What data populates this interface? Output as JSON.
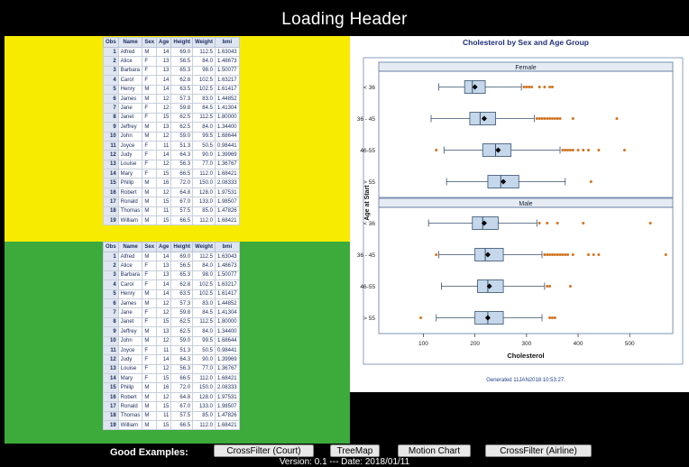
{
  "header": {
    "title": "Loading Header"
  },
  "table": {
    "columns": [
      "Obs",
      "Name",
      "Sex",
      "Age",
      "Height",
      "Weight",
      "bmi"
    ],
    "rows": [
      [
        "1",
        "Alfred",
        "M",
        "14",
        "69.0",
        "112.5",
        "1.63043"
      ],
      [
        "2",
        "Alice",
        "F",
        "13",
        "56.5",
        "84.0",
        "1.48673"
      ],
      [
        "3",
        "Barbara",
        "F",
        "13",
        "65.3",
        "98.0",
        "1.50077"
      ],
      [
        "4",
        "Carol",
        "F",
        "14",
        "62.8",
        "102.5",
        "1.63217"
      ],
      [
        "5",
        "Henry",
        "M",
        "14",
        "63.5",
        "102.5",
        "1.61417"
      ],
      [
        "6",
        "James",
        "M",
        "12",
        "57.3",
        "83.0",
        "1.44852"
      ],
      [
        "7",
        "Jane",
        "F",
        "12",
        "59.8",
        "84.5",
        "1.41304"
      ],
      [
        "8",
        "Janet",
        "F",
        "15",
        "62.5",
        "112.5",
        "1.80000"
      ],
      [
        "9",
        "Jeffrey",
        "M",
        "13",
        "62.5",
        "84.0",
        "1.34400"
      ],
      [
        "10",
        "John",
        "M",
        "12",
        "59.0",
        "99.5",
        "1.68644"
      ],
      [
        "11",
        "Joyce",
        "F",
        "11",
        "51.3",
        "50.5",
        "0.98441"
      ],
      [
        "12",
        "Judy",
        "F",
        "14",
        "64.3",
        "90.0",
        "1.39969"
      ],
      [
        "13",
        "Louise",
        "F",
        "12",
        "56.3",
        "77.0",
        "1.36767"
      ],
      [
        "14",
        "Mary",
        "F",
        "15",
        "66.5",
        "112.0",
        "1.68421"
      ],
      [
        "15",
        "Philip",
        "M",
        "16",
        "72.0",
        "150.0",
        "2.08333"
      ],
      [
        "16",
        "Robert",
        "M",
        "12",
        "64.8",
        "128.0",
        "1.97531"
      ],
      [
        "17",
        "Ronald",
        "M",
        "15",
        "67.0",
        "133.0",
        "1.98507"
      ],
      [
        "18",
        "Thomas",
        "M",
        "11",
        "57.5",
        "85.0",
        "1.47826"
      ],
      [
        "19",
        "William",
        "M",
        "15",
        "66.5",
        "112.0",
        "1.68421"
      ]
    ]
  },
  "chart_data": {
    "type": "boxplot",
    "title": "Cholesterol by Sex and Age Group",
    "xlabel": "Cholesterol",
    "ylabel": "Age at Start",
    "xlim": [
      80,
      580
    ],
    "xticks": [
      100,
      200,
      300,
      400,
      500
    ],
    "categories": [
      "< 36",
      "36 - 45",
      "46-55",
      "> 55"
    ],
    "footnote": "Generated 11JAN2018:10:53:27.",
    "colors": {
      "box": "#c5d7ea",
      "box_border": "#36506e",
      "outlier": "#d0731f",
      "mean": "#000000"
    },
    "panels": [
      {
        "name": "Female",
        "groups": [
          {
            "category": "< 36",
            "whisker_low": 130,
            "q1": 180,
            "median": 195,
            "q3": 220,
            "whisker_high": 290,
            "mean": 200,
            "outliers": [
              295,
              300,
              305,
              310,
              325,
              335,
              345,
              350
            ]
          },
          {
            "category": "36 - 45",
            "whisker_low": 115,
            "q1": 190,
            "median": 210,
            "q3": 240,
            "whisker_high": 315,
            "mean": 218,
            "outliers": [
              320,
              325,
              330,
              335,
              340,
              345,
              350,
              355,
              360,
              365,
              390,
              475
            ]
          },
          {
            "category": "46-55",
            "whisker_low": 140,
            "q1": 215,
            "median": 240,
            "q3": 270,
            "whisker_high": 365,
            "mean": 245,
            "outliers": [
              125,
              370,
              375,
              380,
              385,
              390,
              400,
              410,
              420,
              440,
              490
            ]
          },
          {
            "category": "> 55",
            "whisker_low": 145,
            "q1": 225,
            "median": 250,
            "q3": 285,
            "whisker_high": 375,
            "mean": 255,
            "outliers": [
              425
            ]
          }
        ]
      },
      {
        "name": "Male",
        "groups": [
          {
            "category": "< 36",
            "whisker_low": 110,
            "q1": 195,
            "median": 215,
            "q3": 245,
            "whisker_high": 320,
            "mean": 218,
            "outliers": [
              325,
              340,
              360,
              410,
              540
            ]
          },
          {
            "category": "36 - 45",
            "whisker_low": 130,
            "q1": 200,
            "median": 220,
            "q3": 255,
            "whisker_high": 330,
            "mean": 225,
            "outliers": [
              125,
              335,
              340,
              345,
              350,
              355,
              360,
              365,
              370,
              375,
              380,
              390,
              420,
              430,
              440,
              570
            ]
          },
          {
            "category": "46-55",
            "whisker_low": 135,
            "q1": 205,
            "median": 225,
            "q3": 255,
            "whisker_high": 335,
            "mean": 228,
            "outliers": [
              340,
              345,
              385
            ]
          },
          {
            "category": "> 55",
            "whisker_low": 125,
            "q1": 200,
            "median": 225,
            "q3": 255,
            "whisker_high": 330,
            "mean": 225,
            "outliers": [
              95,
              345,
              350,
              355
            ]
          }
        ]
      }
    ]
  },
  "footer": {
    "good_examples_label": "Good Examples:",
    "buttons": [
      "CrossFilter (Court)",
      "TreeMap",
      "Motion Chart",
      "CrossFilter (Airline)"
    ],
    "version": "Version: 0.1 --- Date: 2018/01/11"
  }
}
